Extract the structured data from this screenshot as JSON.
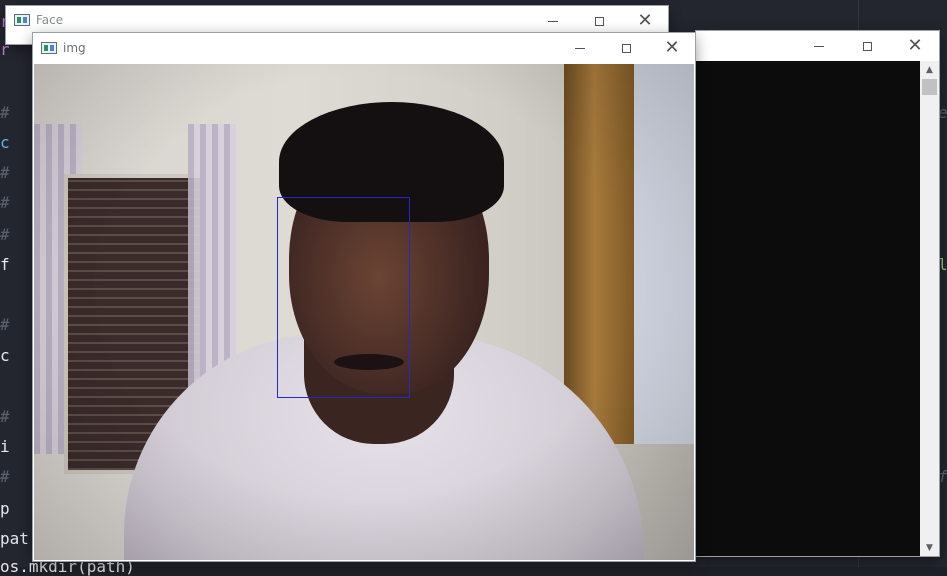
{
  "editor": {
    "fragments": [
      {
        "text": "r",
        "cls": "c-kw"
      },
      {
        "text": "r",
        "cls": "c-kw"
      },
      {
        "text": "#",
        "cls": "c-com"
      },
      {
        "text": "c",
        "cls": "c-fn"
      },
      {
        "text": "#",
        "cls": "c-com"
      },
      {
        "text": "#",
        "cls": "c-com"
      },
      {
        "text": "#",
        "cls": "c-com"
      },
      {
        "text": "f",
        "cls": "c-def"
      },
      {
        "text": "#",
        "cls": "c-com"
      },
      {
        "text": "c",
        "cls": "c-def"
      },
      {
        "text": "#",
        "cls": "c-com"
      },
      {
        "text": "i",
        "cls": "c-def"
      },
      {
        "text": "#",
        "cls": "c-com"
      },
      {
        "text": "p",
        "cls": "c-def"
      },
      {
        "text": "pat",
        "cls": "c-def"
      },
      {
        "text": "os.mkdir(path)",
        "cls": "c-def"
      }
    ],
    "right_fragments": [
      {
        "text": "e",
        "cls": "c-com"
      },
      {
        "text": "l",
        "cls": "c-grn"
      },
      {
        "text": "f",
        "cls": "c-com"
      }
    ]
  },
  "windows": {
    "face": {
      "title": "Face"
    },
    "img": {
      "title": "img"
    },
    "console": {
      "title": ""
    }
  },
  "controls": {
    "minimize": "—",
    "maximize": "☐",
    "close": "✕"
  },
  "detection": {
    "label": "face-detection-box",
    "color": "#2727c8"
  }
}
